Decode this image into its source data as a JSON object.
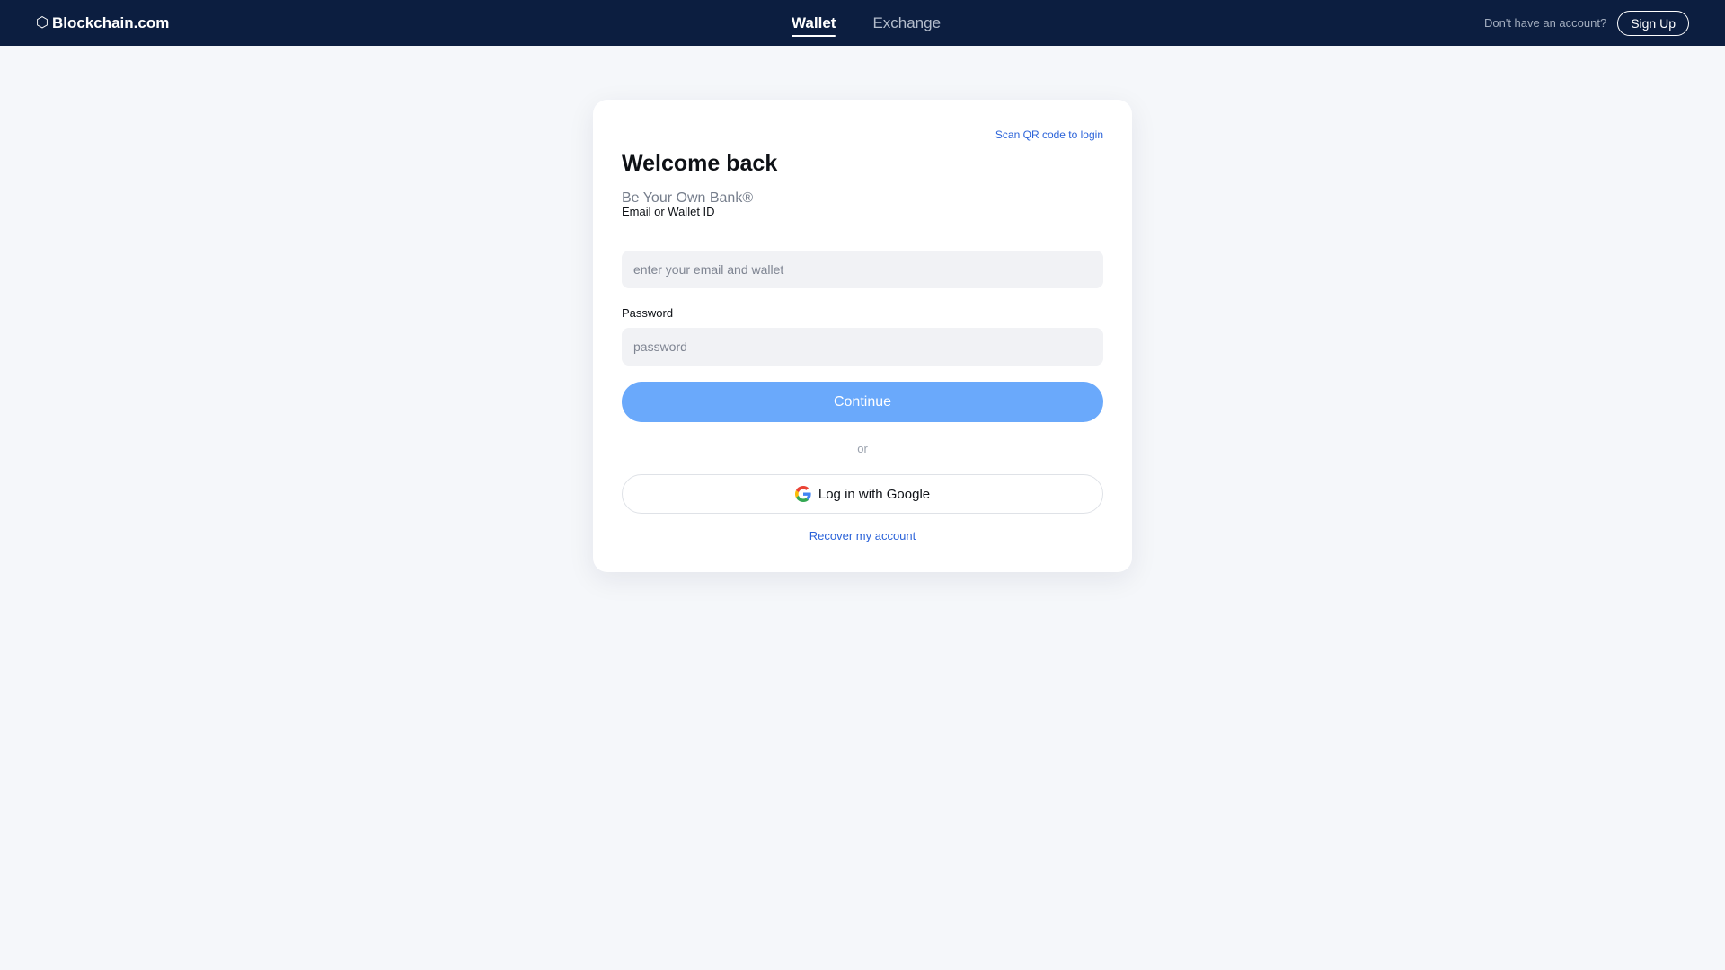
{
  "header": {
    "brand_icon": "⬡",
    "brand_name": "Blockchain.com",
    "tabs": [
      {
        "label": "Wallet",
        "active": true
      },
      {
        "label": "Exchange",
        "active": false
      }
    ],
    "no_account_text": "Don't have an account?",
    "signup_label": "Sign Up"
  },
  "login": {
    "qr_link": "Scan QR code to login",
    "title": "Welcome back",
    "subtitle": "Be Your Own Bank®",
    "email_label": "Email or Wallet ID",
    "email_placeholder": "enter your email and wallet",
    "email_value": "",
    "password_label": "Password",
    "password_placeholder": "password",
    "password_value": "",
    "continue_label": "Continue",
    "or_text": "or",
    "google_label": "Log in with Google",
    "recover_link": "Recover my account"
  },
  "colors": {
    "header_bg": "#0c1e40",
    "page_bg": "#f5f7fa",
    "accent_link": "#2b63d9",
    "continue_button": "#6aa9fb"
  },
  "icons": {
    "brand": "hexagon-icon",
    "google": "google-g-icon"
  }
}
